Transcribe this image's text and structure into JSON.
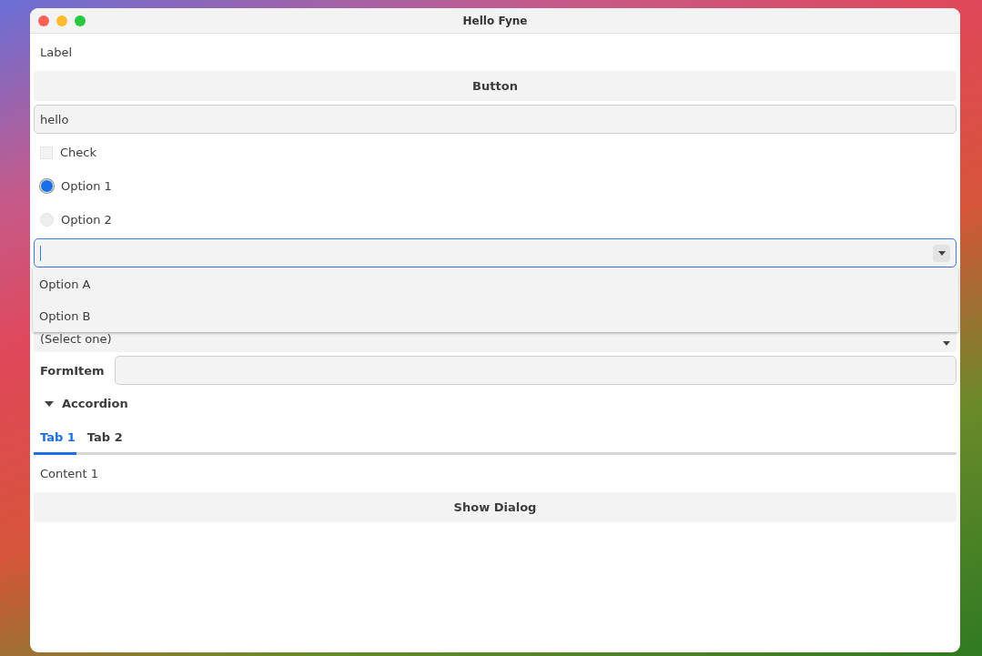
{
  "window": {
    "title": "Hello Fyne"
  },
  "label": "Label",
  "button": "Button",
  "entry": {
    "value": "hello"
  },
  "check": {
    "label": "Check",
    "checked": false
  },
  "radio": [
    {
      "label": "Option 1",
      "selected": true
    },
    {
      "label": "Option 2",
      "selected": false
    }
  ],
  "select_entry": {
    "focused": true,
    "dropdown_open": true,
    "options": [
      "Option A",
      "Option B"
    ]
  },
  "select": {
    "placeholder": "(Select one)"
  },
  "form": {
    "label": "FormItem"
  },
  "accordion": {
    "label": "Accordion",
    "expanded": true
  },
  "tabs": [
    {
      "label": "Tab 1",
      "selected": true
    },
    {
      "label": "Tab 2",
      "selected": false
    }
  ],
  "tab_content": "Content 1",
  "dialog_button": "Show Dialog"
}
